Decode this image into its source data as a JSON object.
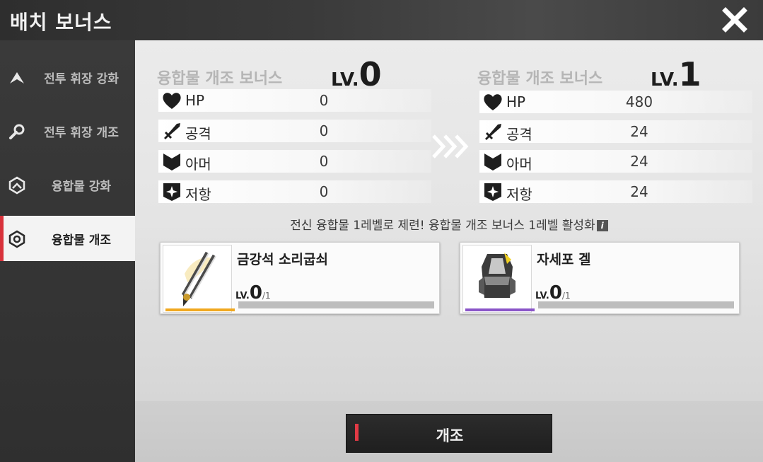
{
  "header": {
    "title": "배치 보너스",
    "close_icon": "close-icon"
  },
  "sidebar": {
    "items": [
      {
        "label": "전투 휘장 강화",
        "icon": "chevron-up-icon",
        "active": false
      },
      {
        "label": "전투 휘장 개조",
        "icon": "wrench-icon",
        "active": false
      },
      {
        "label": "융합물 강화",
        "icon": "rank-up-icon",
        "active": false
      },
      {
        "label": "융합물 개조",
        "icon": "hexagon-shield-icon",
        "active": true
      }
    ]
  },
  "current": {
    "heading": "융합물 개조 보너스",
    "lv_prefix": "LV.",
    "lv": "0",
    "stats": [
      {
        "name": "HP",
        "value": "0",
        "icon": "heart-icon"
      },
      {
        "name": "공격",
        "value": "0",
        "icon": "sword-icon"
      },
      {
        "name": "아머",
        "value": "0",
        "icon": "shield-icon"
      },
      {
        "name": "저항",
        "value": "0",
        "icon": "sparkle-shield-icon"
      }
    ]
  },
  "next": {
    "heading": "융합물 개조 보너스",
    "lv_prefix": "LV.",
    "lv": "1",
    "stats": [
      {
        "name": "HP",
        "value": "480",
        "icon": "heart-icon"
      },
      {
        "name": "공격",
        "value": "24",
        "icon": "sword-icon"
      },
      {
        "name": "아머",
        "value": "24",
        "icon": "shield-icon"
      },
      {
        "name": "저항",
        "value": "24",
        "icon": "sparkle-shield-icon"
      }
    ]
  },
  "notice": {
    "text": "전신 융합물 1레벨로 제련! 융합물 개조 보너스 1레벨 활성화",
    "info_glyph": "i"
  },
  "items": [
    {
      "name": "금강석 소리굽쇠",
      "lv_prefix": "LV.",
      "lv": "0",
      "max": "/1",
      "progress": 0,
      "rarity_color": "#f0a820"
    },
    {
      "name": "자세포 겔",
      "lv_prefix": "LV.",
      "lv": "0",
      "max": "/1",
      "progress": 0,
      "rarity_color": "#8a55c8"
    }
  ],
  "actions": {
    "modify_label": "개조",
    "accent_color": "#e23a45"
  }
}
